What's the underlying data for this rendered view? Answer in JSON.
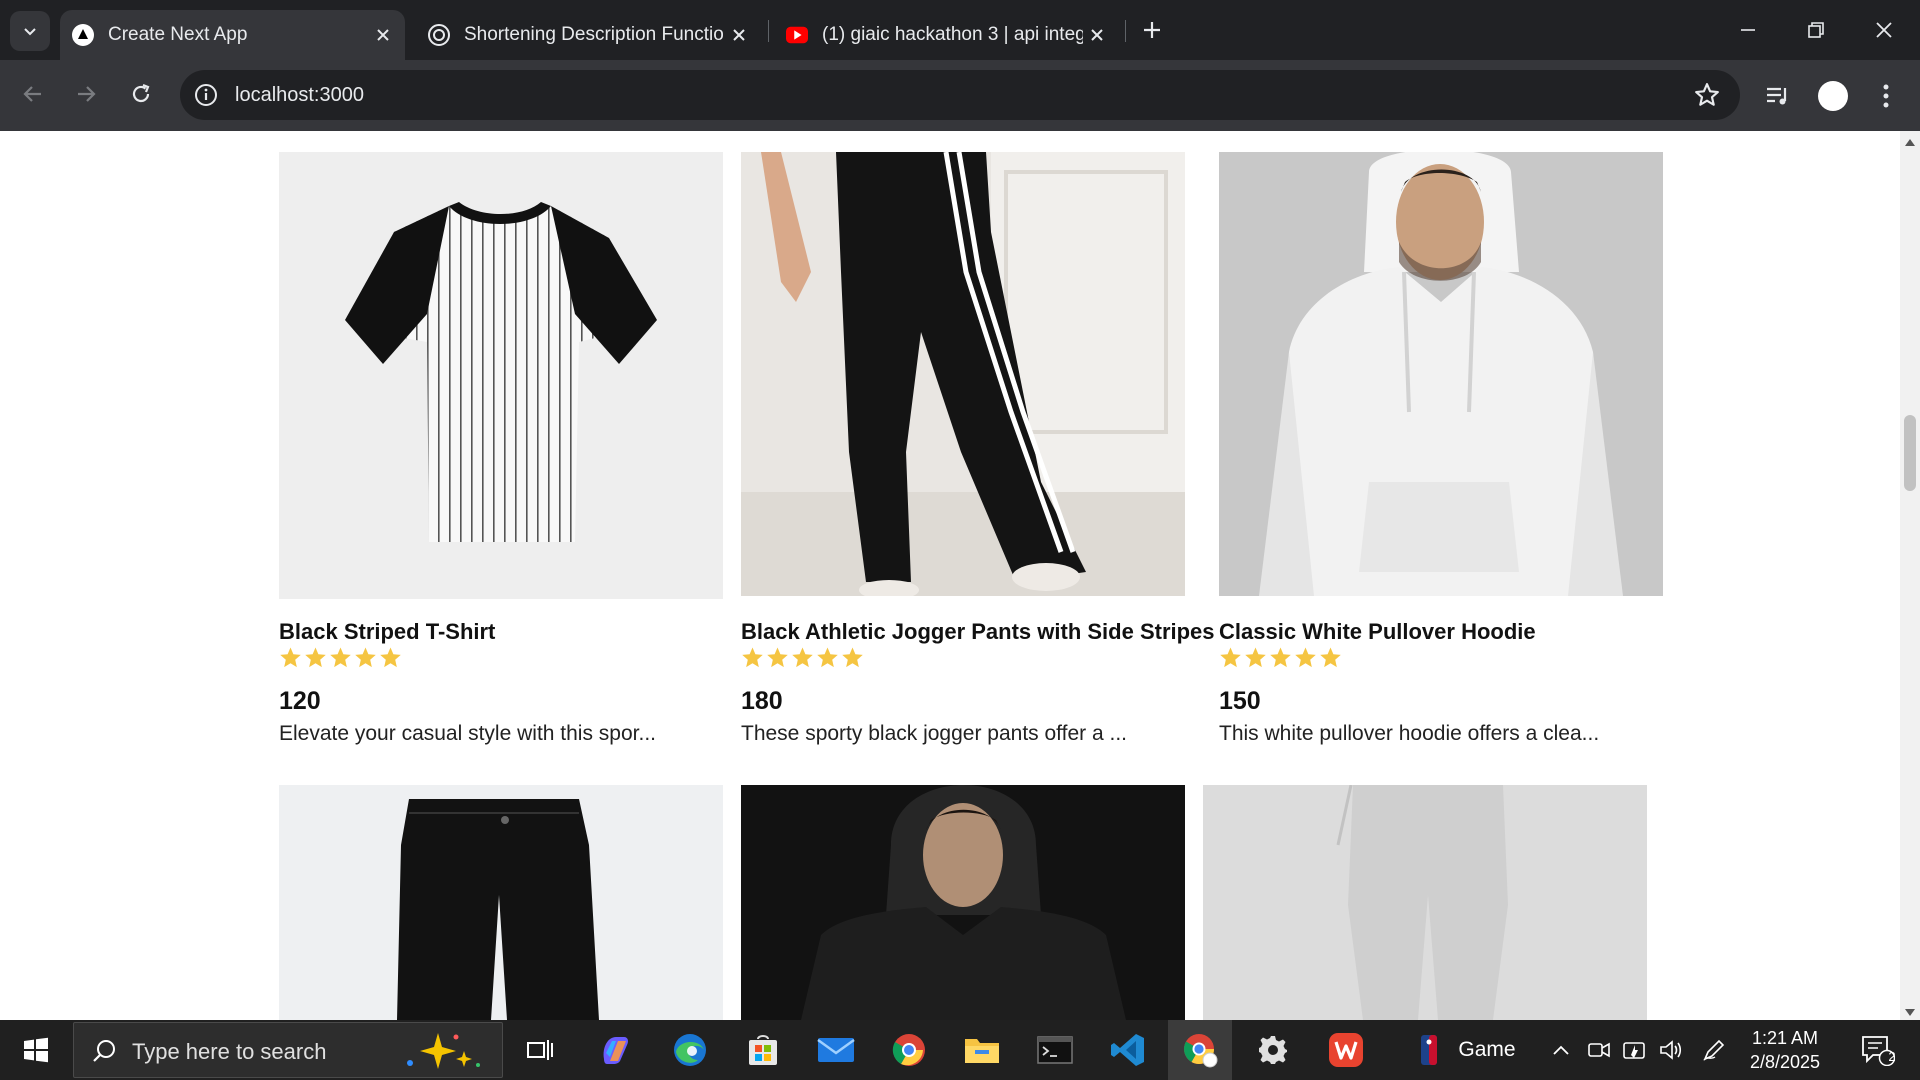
{
  "browser": {
    "tabs": [
      {
        "title": "Create Next App",
        "active": true
      },
      {
        "title": "Shortening Description Functio",
        "active": false
      },
      {
        "title": "(1) giaic hackathon 3 | api integ",
        "active": false
      }
    ],
    "url": "localhost:3000"
  },
  "colors": {
    "star": "#F5C542",
    "chrome_dark": "#202124",
    "chrome_mid": "#35363a",
    "taskbar": "#202020"
  },
  "products": [
    {
      "name": "Black Striped T-Shirt",
      "rating": 5,
      "price": "120",
      "description": "Elevate your casual style with this spor..."
    },
    {
      "name": "Black Athletic Jogger Pants with Side Stripes",
      "rating": 5,
      "price": "180",
      "description": "These sporty black jogger pants offer a ..."
    },
    {
      "name": "Classic White Pullover Hoodie",
      "rating": 5,
      "price": "150",
      "description": "This white pullover hoodie offers a clea..."
    }
  ],
  "taskbar": {
    "search_placeholder": "Type here to search",
    "game_label": "Game",
    "time": "1:21 AM",
    "date": "2/8/2025",
    "notification_count": "2"
  }
}
